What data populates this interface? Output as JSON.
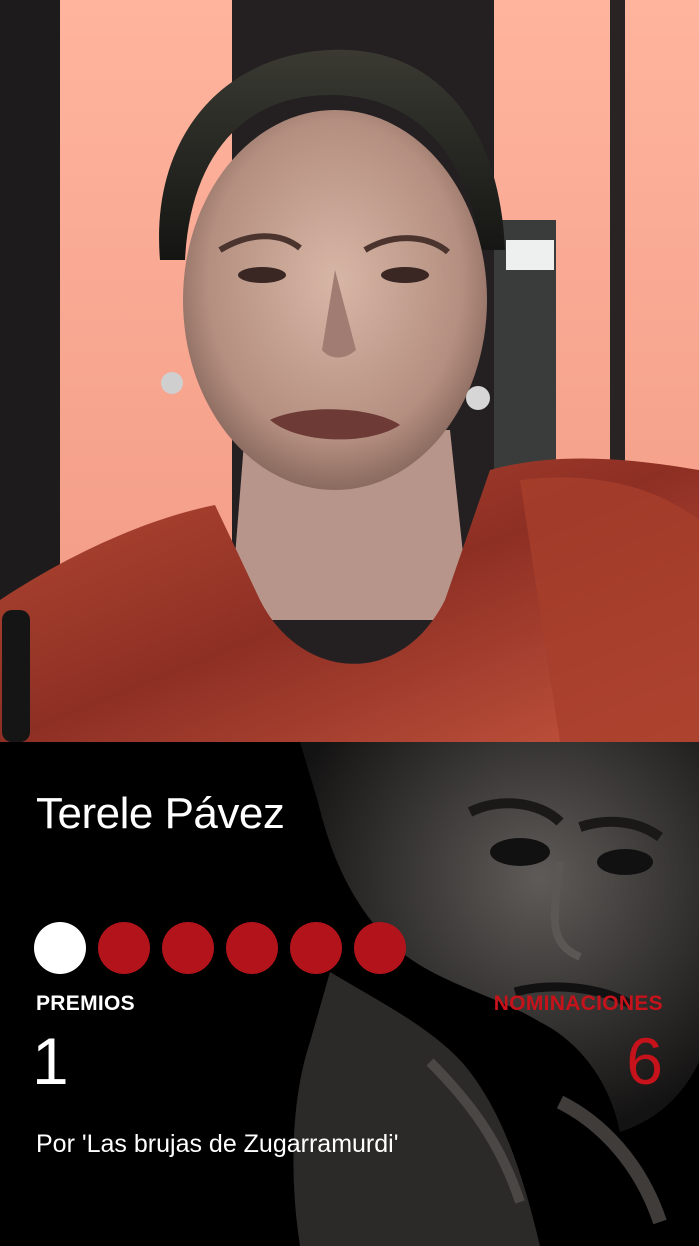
{
  "person": {
    "name": "Terele Pávez"
  },
  "awards": {
    "wins": 1,
    "nominations": 6,
    "premios_label": "PREMIOS",
    "premios_value": "1",
    "nominaciones_label": "NOMINACIONES",
    "nominaciones_value": "6",
    "film": "Por 'Las brujas de Zugarramurdi'"
  },
  "colors": {
    "accent_red": "#b3141c",
    "win_dot": "#ffffff",
    "background": "#000000"
  }
}
